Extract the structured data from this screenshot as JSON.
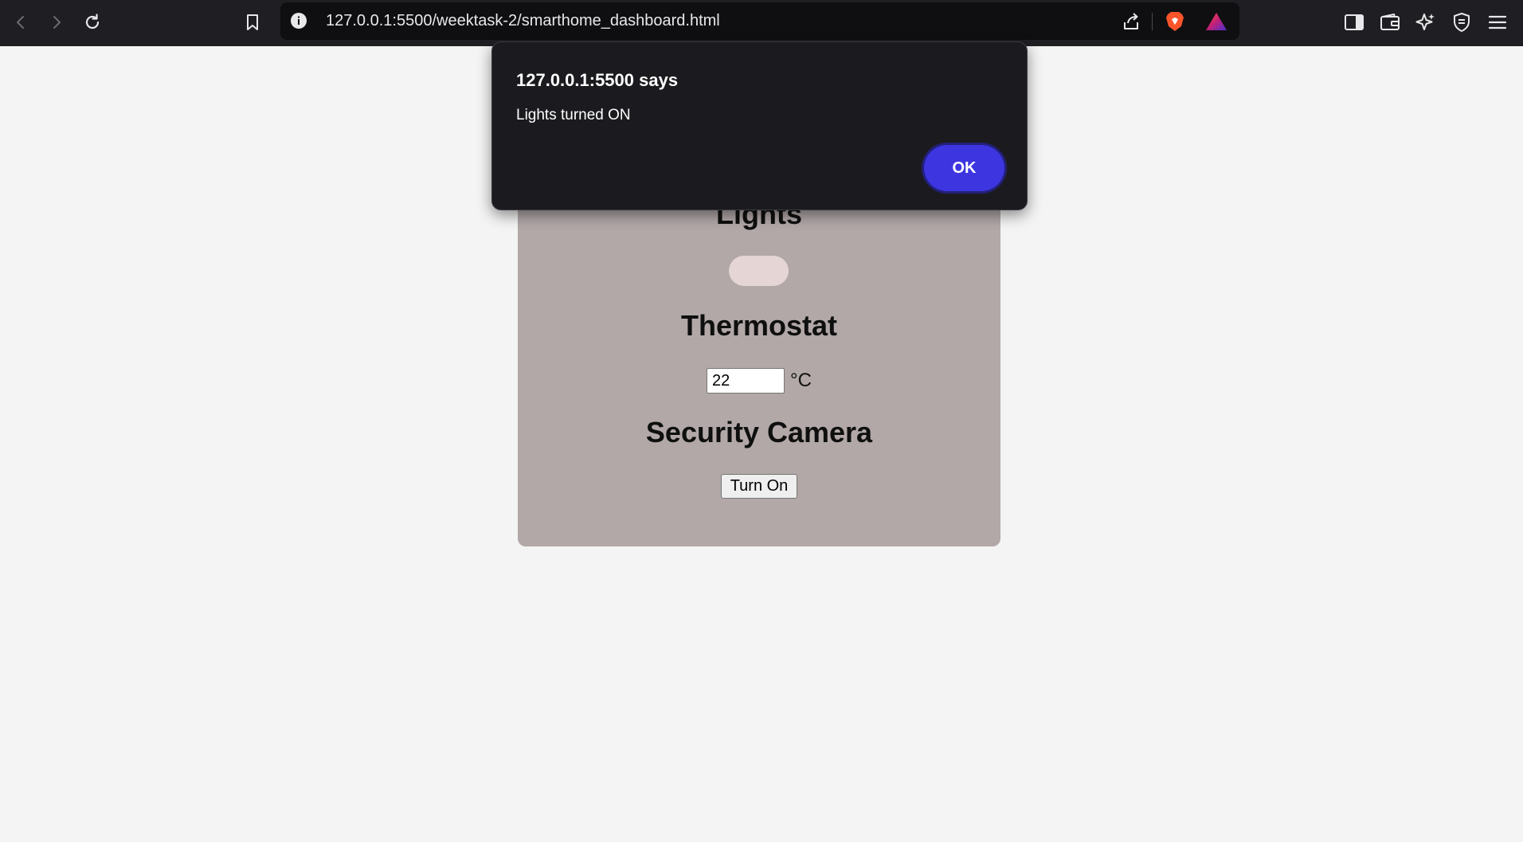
{
  "browser": {
    "url": "127.0.0.1:5500/weektask-2/smarthome_dashboard.html"
  },
  "dashboard": {
    "lights_heading": "Lights",
    "lights_on": true,
    "thermostat_heading": "Thermostat",
    "thermostat_value": "22",
    "thermostat_unit": "°C",
    "camera_heading": "Security Camera",
    "camera_button_label": "Turn On"
  },
  "alert": {
    "title": "127.0.0.1:5500 says",
    "message": "Lights turned ON",
    "ok_label": "OK"
  },
  "colors": {
    "accent": "#3d35e0",
    "card_background": "#b2a8a8",
    "page_background": "#f4f4f4"
  }
}
